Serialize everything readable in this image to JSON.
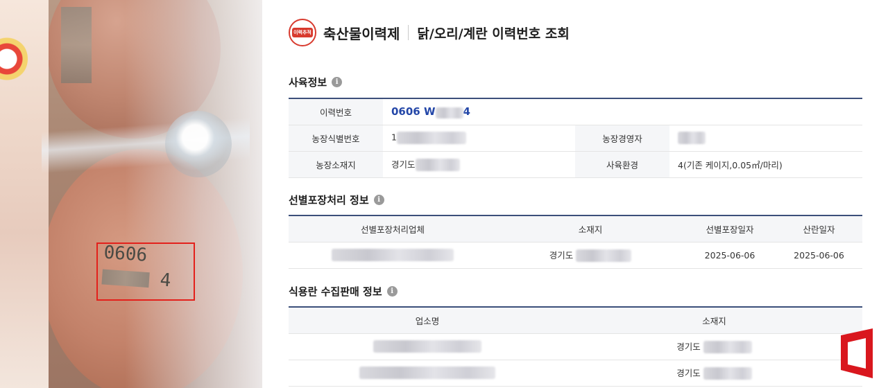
{
  "photo": {
    "egg_code_line1": "0606",
    "egg_code_line2_suffix": "4"
  },
  "header": {
    "logo_text": "이력추적",
    "brand": "축산물이력제",
    "title": "닭/오리/계란 이력번호 조회"
  },
  "sections": {
    "breeding": {
      "title": "사육정보",
      "trace_label": "이력번호",
      "trace_value_prefix": "0606 W",
      "trace_value_suffix": "4",
      "farm_id_label": "농장식별번호",
      "farm_id_prefix": "1",
      "farm_owner_label": "농장경영자",
      "farm_location_label": "농장소재지",
      "farm_location_prefix": "경기도",
      "env_label": "사육환경",
      "env_value": "4(기존 케이지,0.05㎡/마리)"
    },
    "packing": {
      "title": "선별포장처리 정보",
      "columns": [
        "선별포장처리업체",
        "소재지",
        "선별포장일자",
        "산란일자"
      ],
      "rows": [
        {
          "location_prefix": "경기도",
          "pack_date": "2025-06-06",
          "lay_date": "2025-06-06"
        }
      ]
    },
    "sales": {
      "title": "식용란 수집판매 정보",
      "columns": [
        "업소명",
        "소재지"
      ],
      "rows": [
        {
          "location_prefix": "경기도"
        },
        {
          "location_prefix": "경기도"
        }
      ]
    }
  },
  "info_icon_glyph": "i",
  "colors": {
    "accent": "#2447a8",
    "table_border": "#3b4f7a",
    "highlight": "#e3201b",
    "brand_red": "#d83a2e"
  }
}
